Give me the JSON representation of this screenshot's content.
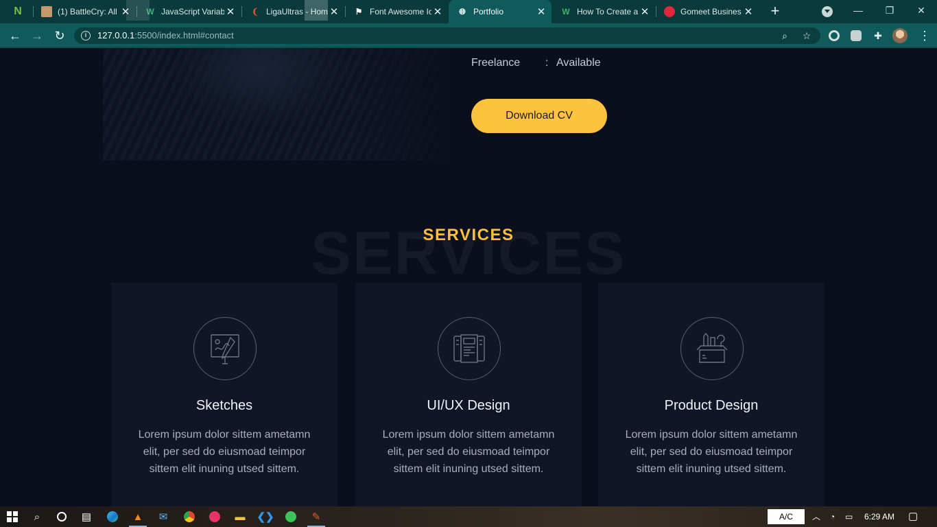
{
  "browser": {
    "tabs": [
      {
        "title": "",
        "favicon": "N",
        "favicon_color": "#7bc043",
        "active": false
      },
      {
        "title": "(1) BattleCry: All",
        "favicon": "avatar",
        "favicon_color": "#c49a6c",
        "active": false
      },
      {
        "title": "JavaScript Variab",
        "favicon": "W",
        "favicon_color": "#3cb371",
        "active": false
      },
      {
        "title": "LigaUltras - Hom",
        "favicon": "flame",
        "favicon_color": "#e0552b",
        "active": false
      },
      {
        "title": "Font Awesome Ic",
        "favicon": "flag",
        "favicon_color": "#ffffff",
        "active": false
      },
      {
        "title": "Portfolio",
        "favicon": "globe",
        "favicon_color": "#ffffff",
        "active": true
      },
      {
        "title": "How To Create a",
        "favicon": "W",
        "favicon_color": "#3cb371",
        "active": false
      },
      {
        "title": "Gomeet Busines",
        "favicon": "circle",
        "favicon_color": "#e0283c",
        "active": false
      }
    ],
    "new_tab_label": "+",
    "url_host": "127.0.0.1",
    "url_rest": ":5500/index.html#contact"
  },
  "about": {
    "freelance_label": "Freelance",
    "colon": ":",
    "freelance_value": "Available",
    "cv_button": "Download CV"
  },
  "services": {
    "bg_text": "SERVICES",
    "title": "SERVICES",
    "cards": [
      {
        "icon": "sketch-icon",
        "title": "Sketches",
        "text": "Lorem ipsum dolor sittem ametamn elit, per sed do eiusmoad teimpor sittem elit inuning utsed sittem."
      },
      {
        "icon": "uiux-icon",
        "title": "UI/UX Design",
        "text": "Lorem ipsum dolor sittem ametamn elit, per sed do eiusmoad teimpor sittem elit inuning utsed sittem."
      },
      {
        "icon": "product-design-icon",
        "title": "Product Design",
        "text": "Lorem ipsum dolor sittem ametamn elit, per sed do eiusmoad teimpor sittem elit inuning utsed sittem."
      }
    ]
  },
  "taskbar": {
    "ac_label": "A/C",
    "time": "6:29 AM"
  },
  "colors": {
    "accent": "#fdc23e",
    "page_bg": "#0b0f1c",
    "card_bg": "#111626",
    "chrome_bg": "#0f5b5c"
  }
}
